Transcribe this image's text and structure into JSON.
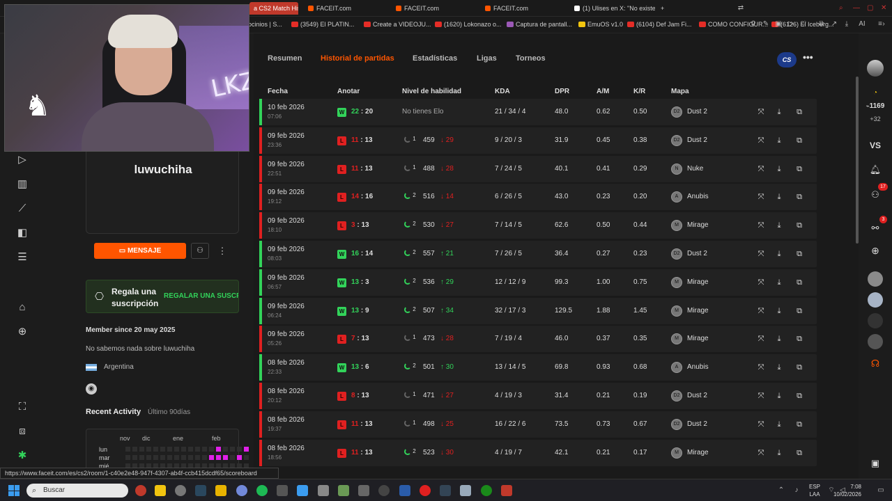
{
  "browser": {
    "tabs": [
      {
        "label": "a CS2 Match Hist",
        "active": true
      },
      {
        "label": "FACEIT.com"
      },
      {
        "label": "FACEIT.com"
      },
      {
        "label": "FACEIT.com"
      },
      {
        "label": "(1) Ulises en X: \"No existe"
      }
    ],
    "new_tab": "+",
    "ai_label": "AI",
    "bookmarks": [
      "ocinios | S...",
      "(3549) El PLATIN...",
      "Create a VIDEOJU...",
      "(1620) Lokonazo o...",
      "Captura de pantall...",
      "EmuOS v1.0",
      "(6104) Def Jam Fi...",
      "COMO CONFIGUR...",
      "(6126) El Iceberg..."
    ]
  },
  "webcam": {
    "wall_text": "LKZ"
  },
  "profile": {
    "username": "luwuchiha",
    "message_label": "MENSAJE",
    "gift_title": "Regala una suscripción",
    "gift_link": "REGALAR UNA SUSCRIPCIÓN",
    "member_since": "Member since 20 may 2025",
    "about": "No sabemos nada sobre luwuchiha",
    "country": "Argentina",
    "recent_activity": "Recent Activity",
    "recent_range": "Último 90días",
    "months": [
      "nov",
      "dic",
      "ene",
      "feb"
    ],
    "days": [
      "lun",
      "mar",
      "mié"
    ],
    "heat_active_color": "#e020e8"
  },
  "subnav": {
    "tabs": [
      "Resumen",
      "Historial de partidas",
      "Estadísticas",
      "Ligas",
      "Torneos"
    ],
    "active": "Historial de partidas",
    "game_badge": "CS"
  },
  "table": {
    "headers": [
      "Fecha",
      "Anotar",
      "Nivel de habilidad",
      "KDA",
      "DPR",
      "A/M",
      "K/R",
      "Mapa"
    ],
    "rows": [
      {
        "date": "10 feb 2026",
        "time": "07:06",
        "result": "W",
        "score_a": "22",
        "score_b": "20",
        "level": "",
        "elo": "",
        "delta": "",
        "no_elo": "No tienes Elo",
        "kda": "21 / 34 / 4",
        "dpr": "48.0",
        "am": "0.62",
        "kr": "0.50",
        "map": "Dust 2"
      },
      {
        "date": "09 feb 2026",
        "time": "23:36",
        "result": "L",
        "score_a": "11",
        "score_b": "13",
        "level": "1",
        "elo": "459",
        "delta": "29",
        "kda": "9 / 20 / 3",
        "dpr": "31.9",
        "am": "0.45",
        "kr": "0.38",
        "map": "Dust 2"
      },
      {
        "date": "09 feb 2026",
        "time": "22:51",
        "result": "L",
        "score_a": "11",
        "score_b": "13",
        "level": "1",
        "elo": "488",
        "delta": "28",
        "kda": "7 / 24 / 5",
        "dpr": "40.1",
        "am": "0.41",
        "kr": "0.29",
        "map": "Nuke"
      },
      {
        "date": "09 feb 2026",
        "time": "19:12",
        "result": "L",
        "score_a": "14",
        "score_b": "16",
        "level": "2",
        "elo": "516",
        "delta": "14",
        "kda": "6 / 26 / 5",
        "dpr": "43.0",
        "am": "0.23",
        "kr": "0.20",
        "map": "Anubis"
      },
      {
        "date": "09 feb 2026",
        "time": "18:10",
        "result": "L",
        "score_a": "3",
        "score_b": "13",
        "level": "2",
        "elo": "530",
        "delta": "27",
        "kda": "7 / 14 / 5",
        "dpr": "62.6",
        "am": "0.50",
        "kr": "0.44",
        "map": "Mirage"
      },
      {
        "date": "09 feb 2026",
        "time": "08:03",
        "result": "W",
        "score_a": "16",
        "score_b": "14",
        "level": "2",
        "elo": "557",
        "delta": "21",
        "kda": "7 / 26 / 5",
        "dpr": "36.4",
        "am": "0.27",
        "kr": "0.23",
        "map": "Dust 2"
      },
      {
        "date": "09 feb 2026",
        "time": "06:57",
        "result": "W",
        "score_a": "13",
        "score_b": "3",
        "level": "2",
        "elo": "536",
        "delta": "29",
        "kda": "12 / 12 / 9",
        "dpr": "99.3",
        "am": "1.00",
        "kr": "0.75",
        "map": "Mirage"
      },
      {
        "date": "09 feb 2026",
        "time": "06:24",
        "result": "W",
        "score_a": "13",
        "score_b": "9",
        "level": "2",
        "elo": "507",
        "delta": "34",
        "kda": "32 / 17 / 3",
        "dpr": "129.5",
        "am": "1.88",
        "kr": "1.45",
        "map": "Mirage"
      },
      {
        "date": "09 feb 2026",
        "time": "05:26",
        "result": "L",
        "score_a": "7",
        "score_b": "13",
        "level": "1",
        "elo": "473",
        "delta": "28",
        "kda": "7 / 19 / 4",
        "dpr": "46.0",
        "am": "0.37",
        "kr": "0.35",
        "map": "Mirage"
      },
      {
        "date": "08 feb 2026",
        "time": "22:33",
        "result": "W",
        "score_a": "13",
        "score_b": "6",
        "level": "2",
        "elo": "501",
        "delta": "30",
        "kda": "13 / 14 / 5",
        "dpr": "69.8",
        "am": "0.93",
        "kr": "0.68",
        "map": "Anubis"
      },
      {
        "date": "08 feb 2026",
        "time": "20:12",
        "result": "L",
        "score_a": "8",
        "score_b": "13",
        "level": "1",
        "elo": "471",
        "delta": "27",
        "kda": "4 / 19 / 3",
        "dpr": "31.4",
        "am": "0.21",
        "kr": "0.19",
        "map": "Dust 2"
      },
      {
        "date": "08 feb 2026",
        "time": "19:37",
        "result": "L",
        "score_a": "11",
        "score_b": "13",
        "level": "1",
        "elo": "498",
        "delta": "25",
        "kda": "16 / 22 / 6",
        "dpr": "73.5",
        "am": "0.73",
        "kr": "0.67",
        "map": "Dust 2"
      },
      {
        "date": "08 feb 2026",
        "time": "18:56",
        "result": "L",
        "score_a": "11",
        "score_b": "13",
        "level": "2",
        "elo": "523",
        "delta": "30",
        "kda": "4 / 19 / 7",
        "dpr": "42.1",
        "am": "0.21",
        "kr": "0.17",
        "map": "Mirage"
      }
    ]
  },
  "right_sidebar": {
    "points": "1169",
    "points_delta": "+32",
    "vs": "VS",
    "friends_badge": "17",
    "party_badge": "3"
  },
  "status_url": "https://www.faceit.com/es/cs2/room/1-c40e2e48-947f-4307-ab4f-ccb415dcdf65/scoreboard",
  "taskbar": {
    "search": "Buscar",
    "lang": "ESP",
    "lang2": "LAA",
    "time": "7:08",
    "date": "10/02/2026"
  },
  "colors": {
    "accent": "#ff5500",
    "win": "#32d35a",
    "loss": "#e02020"
  }
}
